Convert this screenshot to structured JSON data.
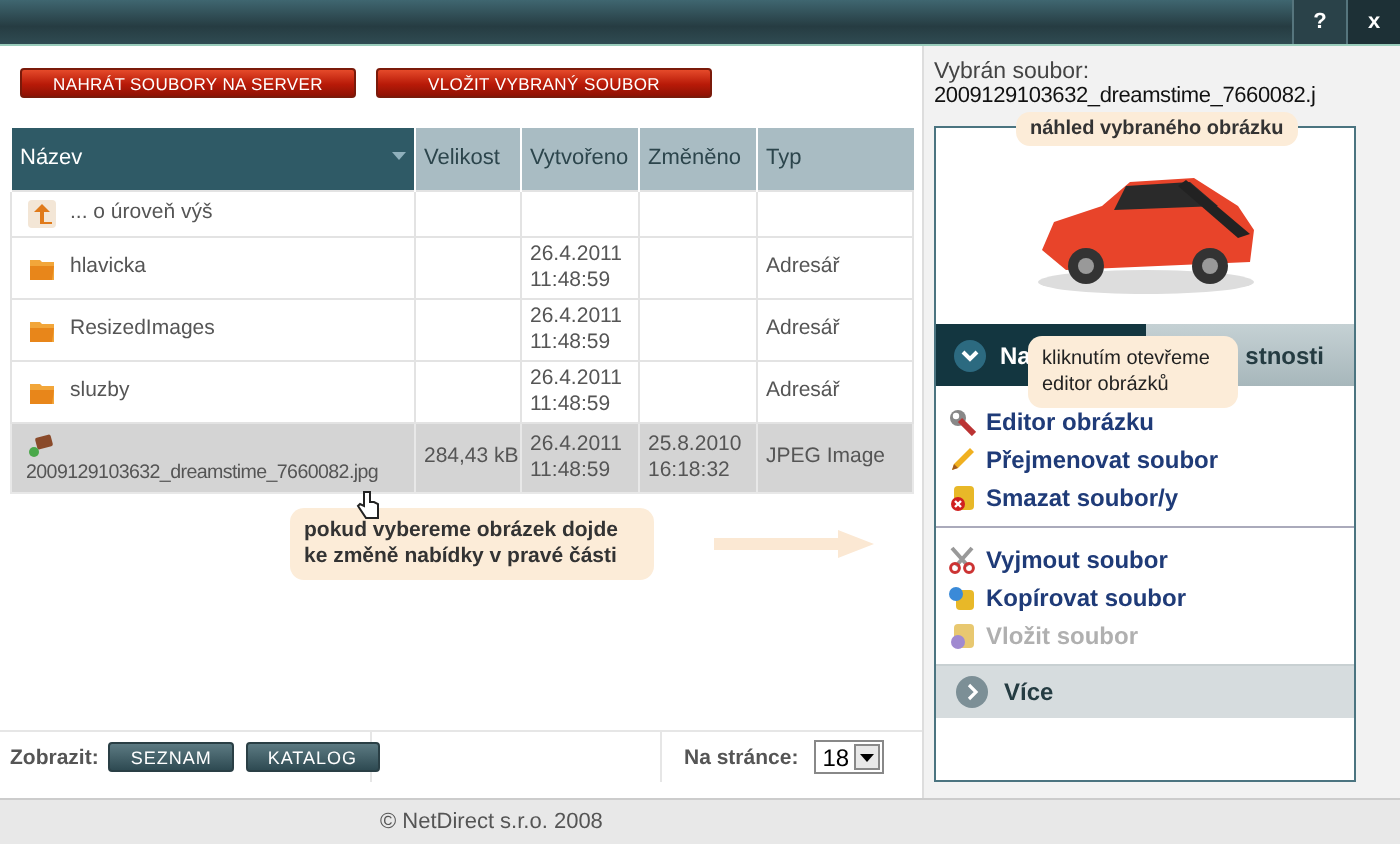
{
  "window": {
    "buttons": [
      {
        "kind": "help",
        "label": "?"
      },
      {
        "kind": "close",
        "label": "x"
      }
    ]
  },
  "toolbar": {
    "buttons": [
      "NAHRÁT SOUBORY NA SERVER",
      "VLOŽIT VYBRANÝ SOUBOR"
    ]
  },
  "table": {
    "columns": [
      {
        "label": "Název",
        "sorted": true
      },
      {
        "label": "Velikost",
        "sorted": false
      },
      {
        "label": "Vytvořeno",
        "sorted": false
      },
      {
        "label": "Změněno",
        "sorted": false
      },
      {
        "label": "Typ",
        "sorted": false
      }
    ],
    "rows": [
      {
        "kind": "parent",
        "name": "... o úroveň výš",
        "selected": false
      },
      {
        "kind": "folder",
        "name": "hlavicka",
        "created": "26.4.2011 11:48:59",
        "type": "Adresář",
        "selected": false
      },
      {
        "kind": "folder",
        "name": "ResizedImages",
        "created": "26.4.2011 11:48:59",
        "type": "Adresář",
        "selected": false
      },
      {
        "kind": "folder",
        "name": "sluzby",
        "created": "26.4.2011 11:48:59",
        "type": "Adresář",
        "selected": false
      },
      {
        "kind": "image",
        "name": "2009129103632_dreamstime_7660082.jpg",
        "size": "284,43 kB",
        "created": "26.4.2011 11:48:59",
        "modified": "25.8.2010 16:18:32",
        "type": "JPEG Image",
        "selected": true
      }
    ]
  },
  "hint": "pokud vybereme obrázek dojde ke změně nabídky v pravé části",
  "view": {
    "label": "Zobrazit:",
    "buttons": [
      "SEZNAM",
      "KATALOG"
    ]
  },
  "per_page": {
    "label": "Na stránce:",
    "value": "18"
  },
  "side": {
    "label": "Vybrán soubor:",
    "file": "2009129103632_dreamstime_7660082.j",
    "preview_hint": "náhled vybraného obrázku",
    "tabs": [
      {
        "label": "Na",
        "selected": true
      },
      {
        "label": "stnosti",
        "selected": false
      }
    ],
    "tab_hint": "kliknutím otevřeme editor obrázků",
    "groups": [
      [
        {
          "kind": "wrench",
          "label": "Editor obrázku",
          "disabled": false
        },
        {
          "kind": "pencil",
          "label": "Přejmenovat soubor",
          "disabled": false
        },
        {
          "kind": "delete",
          "label": "Smazat soubor/y",
          "disabled": false
        }
      ],
      [
        {
          "kind": "scissors",
          "label": "Vyjmout soubor",
          "disabled": false
        },
        {
          "kind": "copy",
          "label": "Kopírovat soubor",
          "disabled": false
        },
        {
          "kind": "paste",
          "label": "Vložit soubor",
          "disabled": true
        }
      ]
    ],
    "more": "Více"
  },
  "footer": "© NetDirect s.r.o. 2008"
}
